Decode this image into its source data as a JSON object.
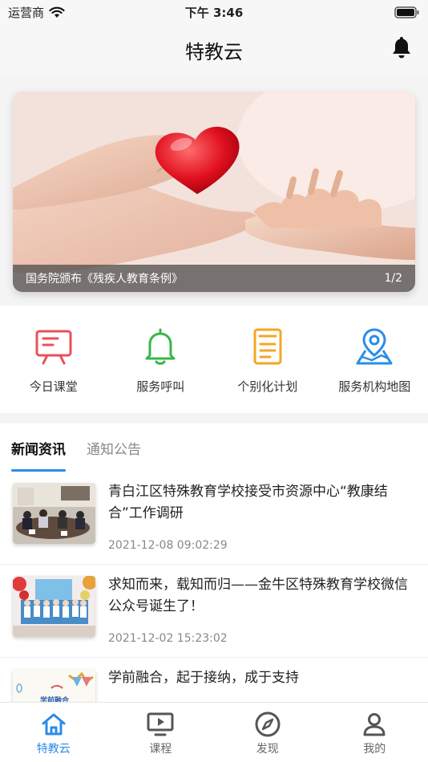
{
  "status": {
    "carrier": "运营商",
    "time": "下午 3:46"
  },
  "header": {
    "title": "特教云"
  },
  "banner": {
    "caption": "国务院颁布《残疾人教育条例》",
    "page": "1/2"
  },
  "quick_actions": [
    {
      "label": "今日课堂",
      "icon": "whiteboard-icon",
      "color": "#e8505b"
    },
    {
      "label": "服务呼叫",
      "icon": "bell-icon",
      "color": "#3bb54a"
    },
    {
      "label": "个别化计划",
      "icon": "document-icon",
      "color": "#f5a623"
    },
    {
      "label": "服务机构地图",
      "icon": "map-pin-icon",
      "color": "#2a8ce8"
    }
  ],
  "news": {
    "tabs": [
      "新闻资讯",
      "通知公告"
    ],
    "articles": [
      {
        "title": "青白江区特殊教育学校接受市资源中心“教康结合”工作调研",
        "time": "2021-12-08 09:02:29"
      },
      {
        "title": "求知而来，载知而归——金牛区特殊教育学校微信公众号诞生了！",
        "time": "2021-12-02 15:23:02"
      },
      {
        "title": "学前融合，起于接纳，成于支持",
        "time": "",
        "thumb_text": "学前融合"
      }
    ]
  },
  "tabbar": [
    {
      "label": "特教云",
      "icon": "home-icon"
    },
    {
      "label": "课程",
      "icon": "video-icon"
    },
    {
      "label": "发现",
      "icon": "compass-icon"
    },
    {
      "label": "我的",
      "icon": "user-icon"
    }
  ],
  "colors": {
    "accent": "#2a8ce8"
  }
}
